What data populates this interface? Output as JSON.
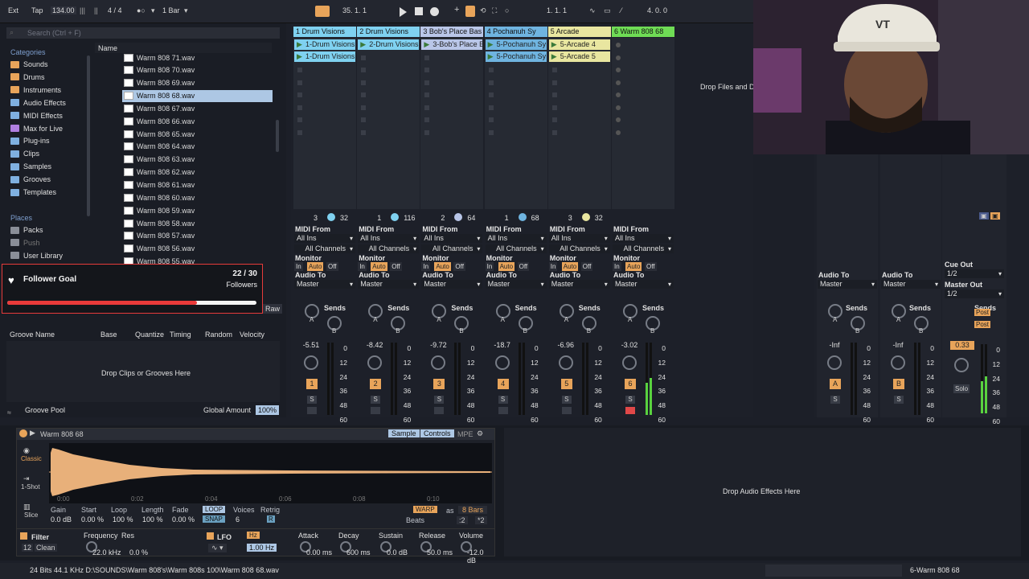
{
  "topbar": {
    "ext": "Ext",
    "tap": "Tap",
    "tempo": "134.00",
    "time_signature": "4 / 4",
    "quantize": "1 Bar",
    "position": "35.  1.  1",
    "loop_start": "1.  1.  1",
    "loop_length": "4.  0.  0"
  },
  "browser": {
    "search_placeholder": "Search (Ctrl + F)",
    "categories_heading": "Categories",
    "categories": [
      "Sounds",
      "Drums",
      "Instruments",
      "Audio Effects",
      "MIDI Effects",
      "Max for Live",
      "Plug-ins",
      "Clips",
      "Samples",
      "Grooves",
      "Templates"
    ],
    "places_heading": "Places",
    "places": [
      "Packs",
      "Push",
      "User Library"
    ],
    "name_column": "Name",
    "files": [
      "Warm 808 71.wav",
      "Warm 808 70.wav",
      "Warm 808 69.wav",
      "Warm 808 68.wav",
      "Warm 808 67.wav",
      "Warm 808 66.wav",
      "Warm 808 65.wav",
      "Warm 808 64.wav",
      "Warm 808 63.wav",
      "Warm 808 62.wav",
      "Warm 808 61.wav",
      "Warm 808 60.wav",
      "Warm 808 59.wav",
      "Warm 808 58.wav",
      "Warm 808 57.wav",
      "Warm 808 56.wav",
      "Warm 808 55.wav"
    ],
    "raw_label": "Raw"
  },
  "follower_goal": {
    "title": "Follower Goal",
    "count": "22 / 30",
    "unit": "Followers",
    "progress": 0.733
  },
  "groove_pool": {
    "columns": [
      "Groove Name",
      "Base",
      "Quantize",
      "Timing",
      "Random",
      "Velocity"
    ],
    "empty_text": "Drop Clips or Grooves Here",
    "footer_label": "Groove Pool",
    "global_amount_label": "Global Amount",
    "global_amount": "100%"
  },
  "session": {
    "drop_files_text": "Drop Files and De",
    "tracks": [
      {
        "name": "1 Drum Visions",
        "color": "#7fd1f0",
        "clips": [
          "1-Drum Visions",
          "1-Drum Visions"
        ],
        "clip_color": "#7fd1f0",
        "s1": "3",
        "s2": "32",
        "vol": "-5.51",
        "num": "1"
      },
      {
        "name": "2 Drum Visions",
        "color": "#7fd1f0",
        "clips": [
          "2-Drum Visions"
        ],
        "clip_color": "#7fd1f0",
        "s1": "1",
        "s2": "116",
        "vol": "-8.42",
        "num": "2"
      },
      {
        "name": "3 Bob's Place Bas",
        "color": "#b9c6e8",
        "clips": [
          "3-Bob's Place B"
        ],
        "clip_color": "#b9c6e8",
        "s1": "2",
        "s2": "64",
        "vol": "-9.72",
        "num": "3"
      },
      {
        "name": "4 Pochanuh Sy",
        "color": "#6fb4e0",
        "clips": [
          "5-Pochanuh Sy",
          "5-Pochanuh Sy"
        ],
        "clip_color": "#6fb4e0",
        "s1": "1",
        "s2": "68",
        "vol": "-18.7",
        "num": "4"
      },
      {
        "name": "5 Arcade",
        "color": "#e9e6a0",
        "clips": [
          "5-Arcade 4",
          "5-Arcade 5"
        ],
        "clip_color": "#e9e6a0",
        "s1": "3",
        "s2": "32",
        "vol": "-6.96",
        "num": "5"
      },
      {
        "name": "6 Warm 808 68",
        "color": "#6fdc55",
        "clips": [],
        "clip_color": "#6fdc55",
        "s1": "",
        "s2": "",
        "vol": "-3.02",
        "num": "6"
      }
    ],
    "returns": [
      {
        "letter": "A",
        "vol": "-Inf"
      },
      {
        "letter": "B",
        "vol": "-Inf"
      }
    ],
    "master_vol": "0.33",
    "midi_from": "MIDI From",
    "all_ins": "All Ins",
    "all_channels": "All Channels",
    "monitor": "Monitor",
    "mon_in": "In",
    "mon_auto": "Auto",
    "mon_off": "Off",
    "audio_to": "Audio To",
    "master": "Master",
    "sends": "Sends",
    "send_a": "A",
    "send_b": "B",
    "cue_out": "Cue Out",
    "cue_out_val": "1/2",
    "master_out": "Master Out",
    "master_out_val": "1/2",
    "post": "Post",
    "solo": "Solo",
    "solo_s": "S",
    "meter_scale": [
      "0",
      "12",
      "24",
      "36",
      "48",
      "60"
    ]
  },
  "simpler": {
    "title": "Warm 808 68",
    "tab_sample": "Sample",
    "tab_controls": "Controls",
    "tab_mpe": "MPE",
    "mode_classic": "Classic",
    "mode_1shot": "1-Shot",
    "mode_slice": "Slice",
    "timeline": [
      "0:00",
      "0:02",
      "0:04",
      "0:06",
      "0:08",
      "0:10"
    ],
    "params": {
      "gain": "Gain",
      "start": "Start",
      "loop": "Loop",
      "length": "Length",
      "fade": "Fade",
      "loop_btn": "LOOP",
      "voices": "Voices",
      "retrig": "Retrig",
      "snap_btn": "SNAP",
      "voices_val": "6",
      "retrig_val": "R"
    },
    "values": {
      "gain": "0.0 dB",
      "start": "0.00 %",
      "loop": "100 %",
      "length": "100 %",
      "fade": "0.00 %"
    },
    "warp": "WARP",
    "as": "as",
    "bars": "8 Bars",
    "beats": "Beats",
    "div2": ":2",
    "mul2": "*2",
    "filter": "Filter",
    "filter_freq_label": "Frequency",
    "filter_res_label": "Res",
    "filter_type": "12",
    "filter_circuit": "Clean",
    "filter_freq": "22.0 kHz",
    "filter_res": "0.0 %",
    "lfo": "LFO",
    "lfo_hz": "Hz",
    "lfo_rate": "1.00 Hz",
    "env": {
      "attack": "Attack",
      "decay": "Decay",
      "sustain": "Sustain",
      "release": "Release",
      "volume": "Volume"
    },
    "env_vals": {
      "attack": "0.00 ms",
      "decay": "600 ms",
      "sustain": "0.0 dB",
      "release": "50.0 ms",
      "volume": "-12.0 dB"
    }
  },
  "effects_drop": "Drop Audio Effects Here",
  "status": {
    "file_info": "24 Bits 44.1 KHz D:\\SOUNDS\\Warm 808's\\Warm 808s 100\\Warm 808 68.wav",
    "track_name": "6-Warm 808 68"
  },
  "webcam": {
    "cap_text": "VT"
  },
  "colors": {
    "accent_orange": "#e8a45a",
    "selection_blue": "#adc7e4",
    "waveform": "#e8b07a",
    "follower_red": "#ea3a3a"
  }
}
